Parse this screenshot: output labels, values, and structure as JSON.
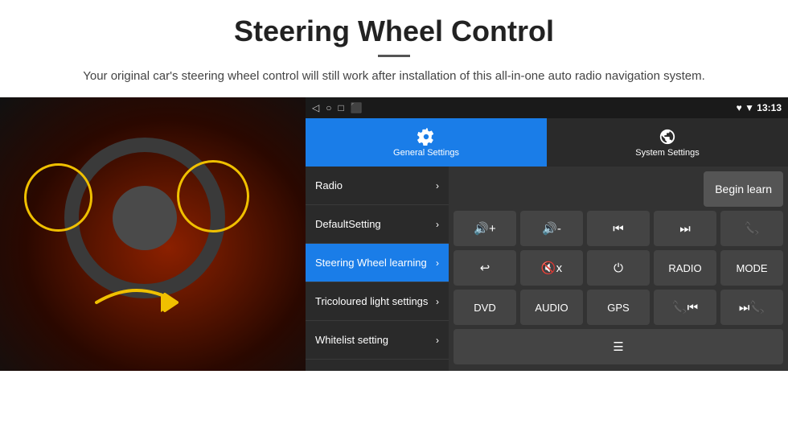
{
  "header": {
    "title": "Steering Wheel Control",
    "divider": true,
    "subtitle": "Your original car's steering wheel control will still work after installation of this all-in-one auto radio navigation system."
  },
  "status_bar": {
    "icons": [
      "◁",
      "○",
      "□",
      "⬛"
    ],
    "right": "♥ ▼ 13:13"
  },
  "tabs": [
    {
      "label": "General Settings",
      "active": true
    },
    {
      "label": "System Settings",
      "active": false
    }
  ],
  "menu_items": [
    {
      "label": "Radio",
      "active": false
    },
    {
      "label": "DefaultSetting",
      "active": false
    },
    {
      "label": "Steering Wheel learning",
      "active": true
    },
    {
      "label": "Tricoloured light settings",
      "active": false
    },
    {
      "label": "Whitelist setting",
      "active": false
    }
  ],
  "controls": {
    "begin_learn": "Begin learn",
    "row1": [
      "🔊+",
      "🔊-",
      "⏮",
      "⏭",
      "📞"
    ],
    "row2": [
      "↩",
      "🔊x",
      "⏻",
      "RADIO",
      "MODE"
    ],
    "row3": [
      "DVD",
      "AUDIO",
      "GPS",
      "📞⏮",
      "⏭📞"
    ],
    "row4_icon": "≡"
  }
}
